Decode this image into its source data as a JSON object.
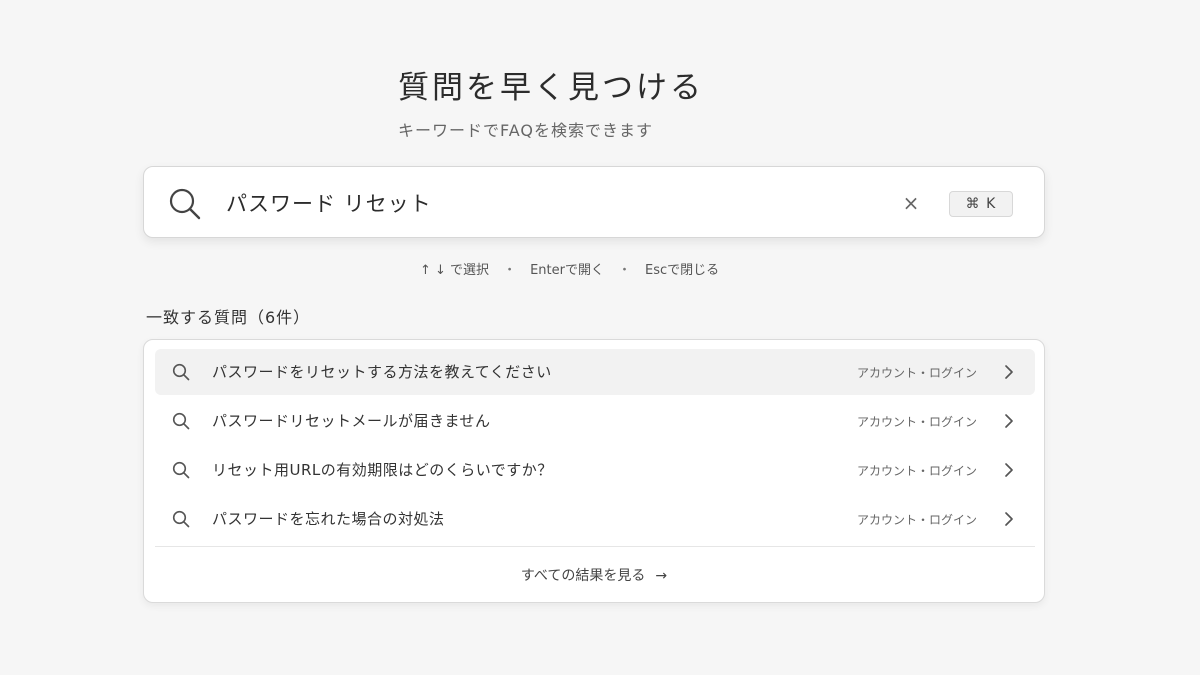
{
  "header": {
    "title": "質問を早く見つける",
    "subtitle": "キーワードでFAQを検索できます"
  },
  "search": {
    "value": "パスワード リセット",
    "clear_label": "×",
    "shortcut": "⌘ K"
  },
  "hints": {
    "select": "↑ ↓ で選択",
    "open": "Enterで開く",
    "close": "Escで閉じる",
    "separator": "・"
  },
  "results": {
    "label": "一致する質問（6件）",
    "items": [
      {
        "text": "パスワードをリセットする方法を教えてください",
        "category": "アカウント・ログイン",
        "active": true
      },
      {
        "text": "パスワードリセットメールが届きません",
        "category": "アカウント・ログイン",
        "active": false
      },
      {
        "text": "リセット用URLの有効期限はどのくらいですか？",
        "category": "アカウント・ログイン",
        "active": false
      },
      {
        "text": "パスワードを忘れた場合の対処法",
        "category": "アカウント・ログイン",
        "active": false
      }
    ],
    "see_all": "すべての結果を見る",
    "see_all_arrow": "→"
  },
  "icons": {
    "search": "search-icon",
    "clear": "close-icon",
    "chevron": "chevron-right-icon",
    "arrow": "arrow-right-icon"
  },
  "colors": {
    "background": "#f6f6f6",
    "card": "#ffffff",
    "active_row": "#f2f2f2",
    "text": "#333333",
    "muted": "#666666"
  }
}
